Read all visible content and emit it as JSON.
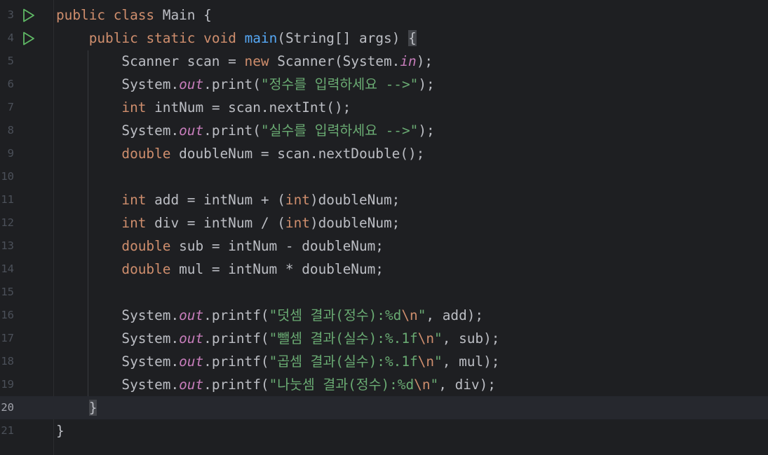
{
  "colors": {
    "background": "#1e1f22",
    "current_line": "#26282e",
    "line_number": "#4b5059",
    "keyword": "#cf8e6d",
    "function": "#56a8f5",
    "string": "#6aab73",
    "static_field": "#c77dbb",
    "text": "#bcbec4",
    "run_icon": "#5fb865"
  },
  "editor": {
    "current_line": "20",
    "lines": [
      {
        "num": "3",
        "run": true,
        "tokens": [
          {
            "t": "public",
            "c": "kw"
          },
          {
            "t": " ",
            "c": "pl"
          },
          {
            "t": "class",
            "c": "kw"
          },
          {
            "t": " Main {",
            "c": "pl"
          }
        ]
      },
      {
        "num": "4",
        "run": true,
        "tokens": [
          {
            "t": "    ",
            "c": "pl"
          },
          {
            "t": "public",
            "c": "kw"
          },
          {
            "t": " ",
            "c": "pl"
          },
          {
            "t": "static",
            "c": "kw"
          },
          {
            "t": " ",
            "c": "pl"
          },
          {
            "t": "void",
            "c": "kw"
          },
          {
            "t": " ",
            "c": "pl"
          },
          {
            "t": "main",
            "c": "fn"
          },
          {
            "t": "(String[] args) ",
            "c": "pl"
          },
          {
            "t": "{",
            "c": "pl",
            "hl": true
          }
        ]
      },
      {
        "num": "5",
        "tokens": [
          {
            "t": "        Scanner scan = ",
            "c": "pl"
          },
          {
            "t": "new",
            "c": "kw"
          },
          {
            "t": " Scanner(System.",
            "c": "pl"
          },
          {
            "t": "in",
            "c": "st"
          },
          {
            "t": ");",
            "c": "pl"
          }
        ]
      },
      {
        "num": "6",
        "tokens": [
          {
            "t": "        System.",
            "c": "pl"
          },
          {
            "t": "out",
            "c": "st"
          },
          {
            "t": ".print(",
            "c": "pl"
          },
          {
            "t": "\"정수를 입력하세요 -->\"",
            "c": "str"
          },
          {
            "t": ");",
            "c": "pl"
          }
        ]
      },
      {
        "num": "7",
        "tokens": [
          {
            "t": "        ",
            "c": "pl"
          },
          {
            "t": "int",
            "c": "kw"
          },
          {
            "t": " intNum = scan.nextInt();",
            "c": "pl"
          }
        ]
      },
      {
        "num": "8",
        "tokens": [
          {
            "t": "        System.",
            "c": "pl"
          },
          {
            "t": "out",
            "c": "st"
          },
          {
            "t": ".print(",
            "c": "pl"
          },
          {
            "t": "\"실수를 입력하세요 -->\"",
            "c": "str"
          },
          {
            "t": ");",
            "c": "pl"
          }
        ]
      },
      {
        "num": "9",
        "tokens": [
          {
            "t": "        ",
            "c": "pl"
          },
          {
            "t": "double",
            "c": "kw"
          },
          {
            "t": " doubleNum = scan.nextDouble();",
            "c": "pl"
          }
        ]
      },
      {
        "num": "10",
        "tokens": []
      },
      {
        "num": "11",
        "tokens": [
          {
            "t": "        ",
            "c": "pl"
          },
          {
            "t": "int",
            "c": "kw"
          },
          {
            "t": " add = intNum + (",
            "c": "pl"
          },
          {
            "t": "int",
            "c": "kw"
          },
          {
            "t": ")doubleNum;",
            "c": "pl"
          }
        ]
      },
      {
        "num": "12",
        "tokens": [
          {
            "t": "        ",
            "c": "pl"
          },
          {
            "t": "int",
            "c": "kw"
          },
          {
            "t": " div = intNum / (",
            "c": "pl"
          },
          {
            "t": "int",
            "c": "kw"
          },
          {
            "t": ")doubleNum;",
            "c": "pl"
          }
        ]
      },
      {
        "num": "13",
        "tokens": [
          {
            "t": "        ",
            "c": "pl"
          },
          {
            "t": "double",
            "c": "kw"
          },
          {
            "t": " sub = intNum - doubleNum;",
            "c": "pl"
          }
        ]
      },
      {
        "num": "14",
        "tokens": [
          {
            "t": "        ",
            "c": "pl"
          },
          {
            "t": "double",
            "c": "kw"
          },
          {
            "t": " mul = intNum * doubleNum;",
            "c": "pl"
          }
        ]
      },
      {
        "num": "15",
        "tokens": []
      },
      {
        "num": "16",
        "tokens": [
          {
            "t": "        System.",
            "c": "pl"
          },
          {
            "t": "out",
            "c": "st"
          },
          {
            "t": ".printf(",
            "c": "pl"
          },
          {
            "t": "\"덧셈 결과(정수):%d",
            "c": "str"
          },
          {
            "t": "\\n",
            "c": "esc"
          },
          {
            "t": "\"",
            "c": "str"
          },
          {
            "t": ", add);",
            "c": "pl"
          }
        ]
      },
      {
        "num": "17",
        "tokens": [
          {
            "t": "        System.",
            "c": "pl"
          },
          {
            "t": "out",
            "c": "st"
          },
          {
            "t": ".printf(",
            "c": "pl"
          },
          {
            "t": "\"뺄셈 결과(실수):%.1f",
            "c": "str"
          },
          {
            "t": "\\n",
            "c": "esc"
          },
          {
            "t": "\"",
            "c": "str"
          },
          {
            "t": ", sub);",
            "c": "pl"
          }
        ]
      },
      {
        "num": "18",
        "tokens": [
          {
            "t": "        System.",
            "c": "pl"
          },
          {
            "t": "out",
            "c": "st"
          },
          {
            "t": ".printf(",
            "c": "pl"
          },
          {
            "t": "\"곱셈 결과(실수):%.1f",
            "c": "str"
          },
          {
            "t": "\\n",
            "c": "esc"
          },
          {
            "t": "\"",
            "c": "str"
          },
          {
            "t": ", mul);",
            "c": "pl"
          }
        ]
      },
      {
        "num": "19",
        "tokens": [
          {
            "t": "        System.",
            "c": "pl"
          },
          {
            "t": "out",
            "c": "st"
          },
          {
            "t": ".printf(",
            "c": "pl"
          },
          {
            "t": "\"나눗셈 결과(정수):%d",
            "c": "str"
          },
          {
            "t": "\\n",
            "c": "esc"
          },
          {
            "t": "\"",
            "c": "str"
          },
          {
            "t": ", div);",
            "c": "pl"
          }
        ]
      },
      {
        "num": "20",
        "tokens": [
          {
            "t": "    ",
            "c": "pl"
          },
          {
            "t": "}",
            "c": "pl",
            "hl": true
          }
        ]
      },
      {
        "num": "21",
        "tokens": [
          {
            "t": "}",
            "c": "pl"
          }
        ]
      }
    ]
  }
}
